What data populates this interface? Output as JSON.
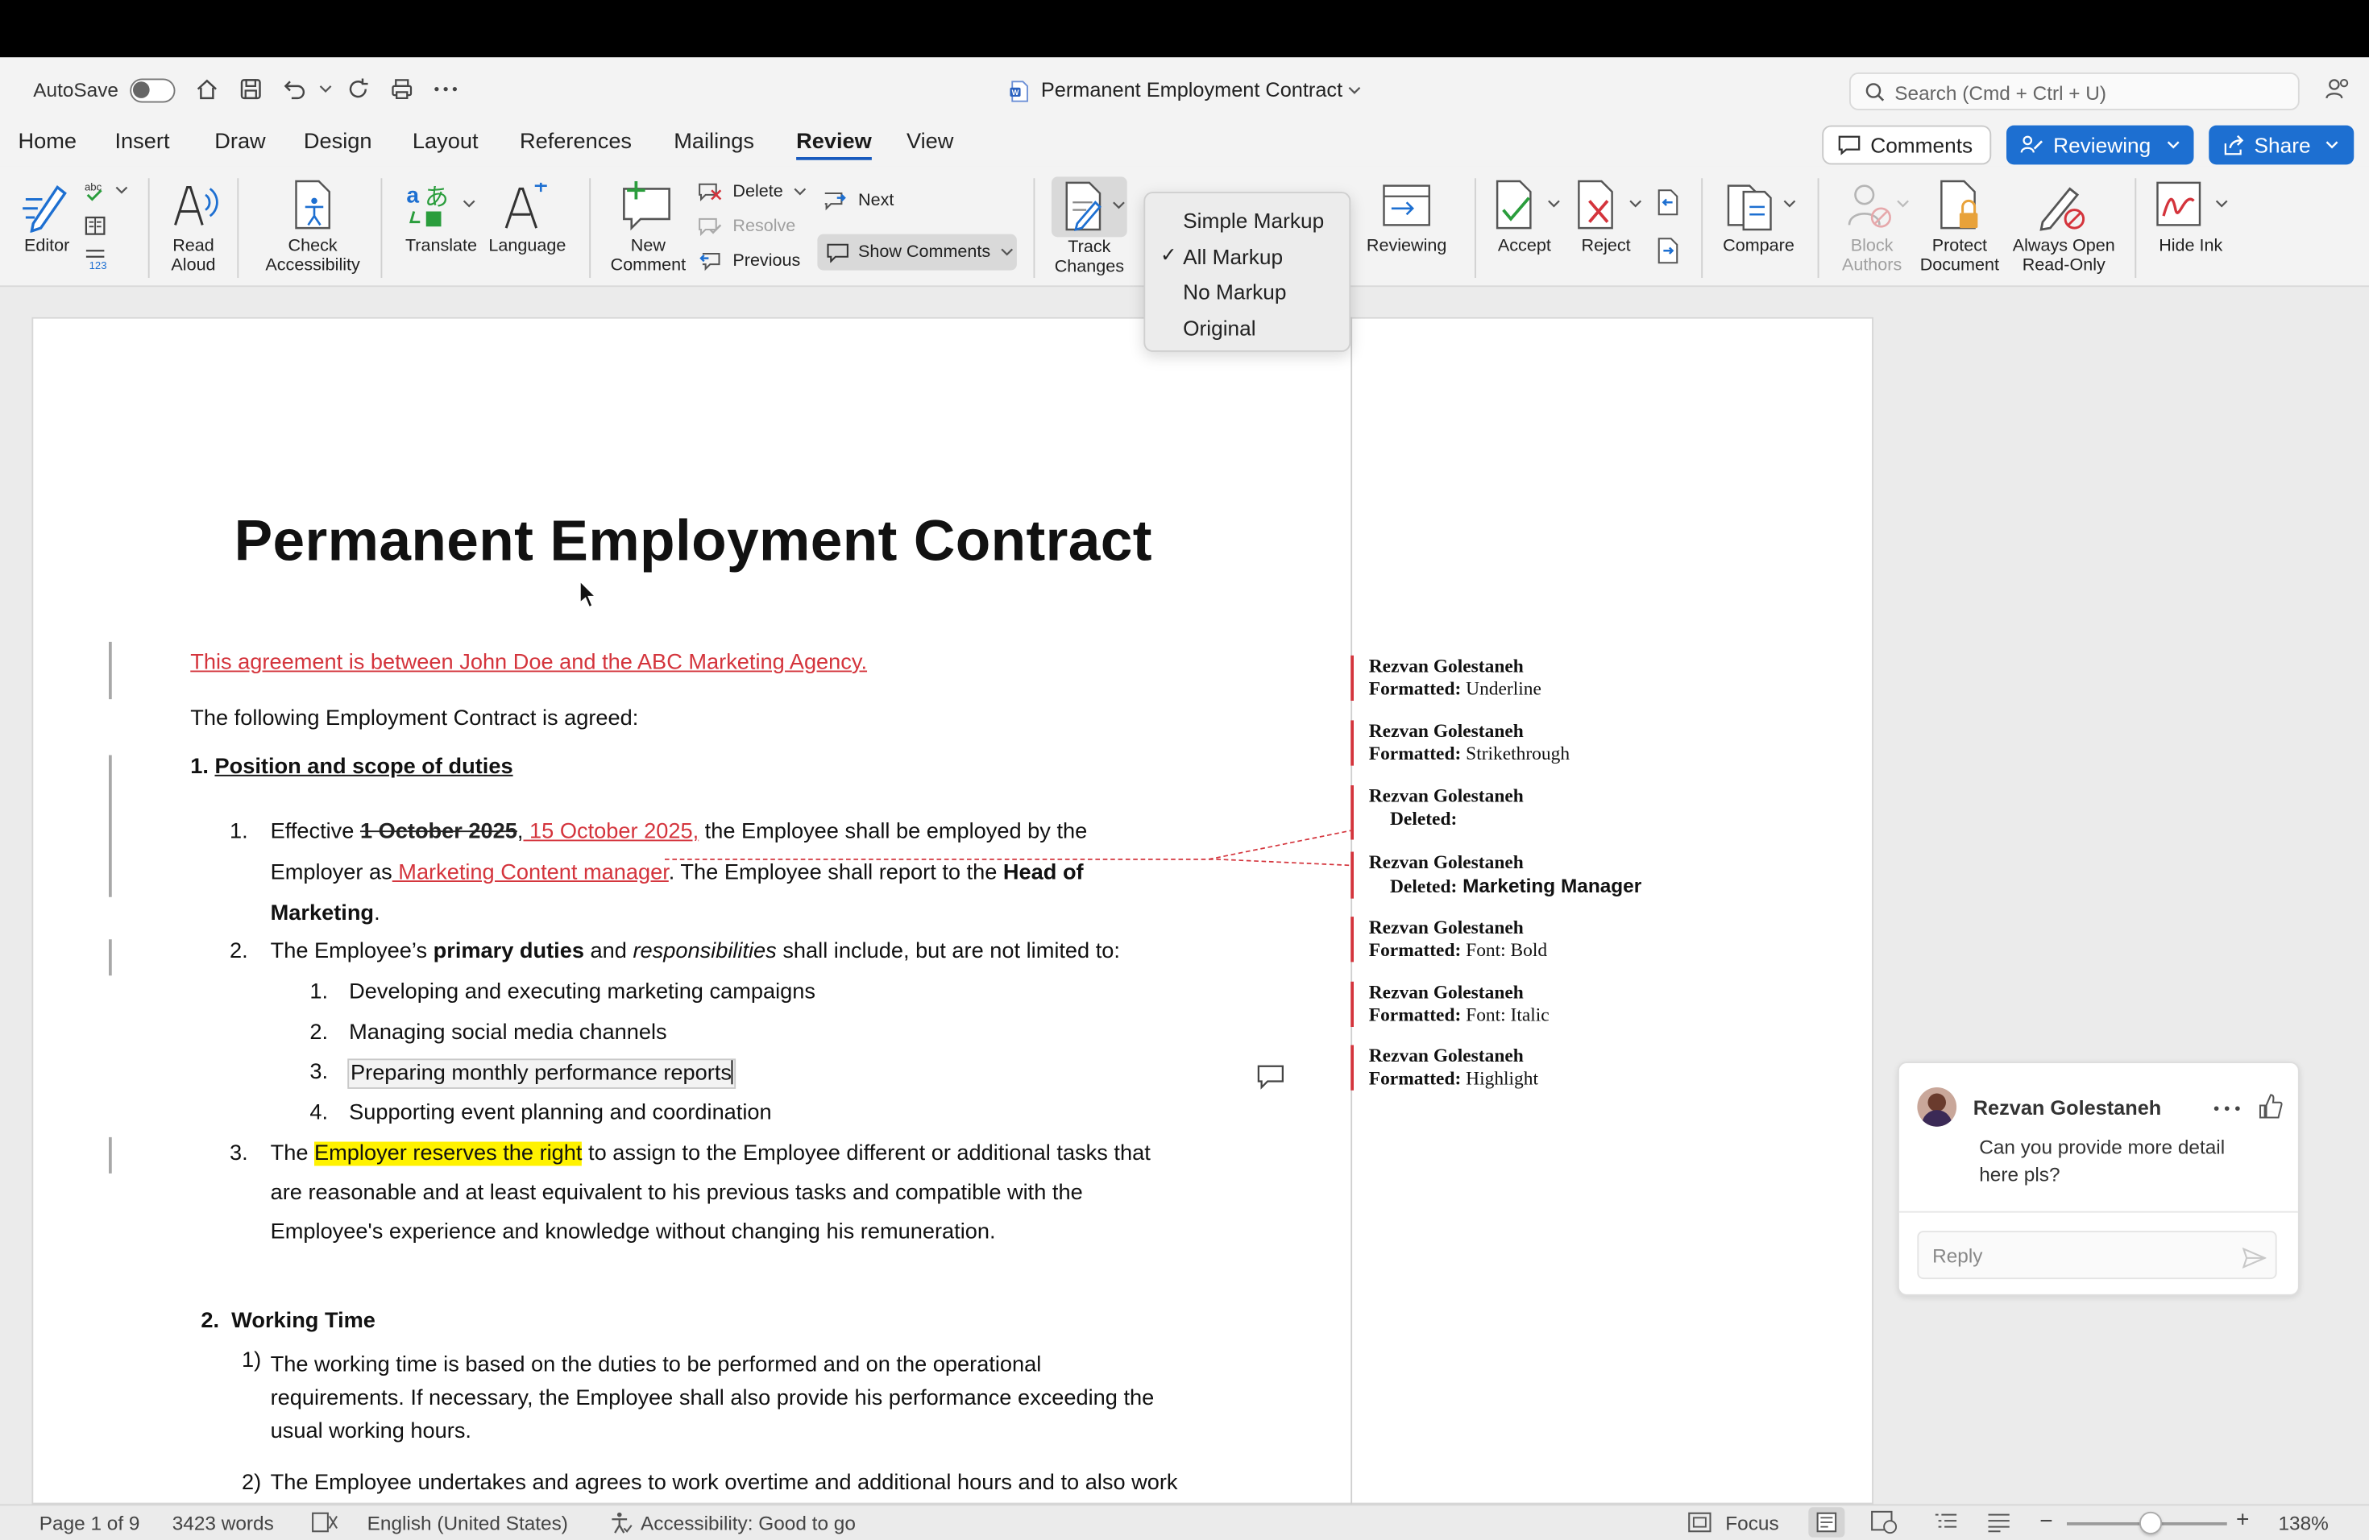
{
  "app": {
    "autosave_label": "AutoSave",
    "document_title": "Permanent Employment Contract",
    "search_placeholder": "Search (Cmd + Ctrl + U)"
  },
  "menu_tabs": [
    "Home",
    "Insert",
    "Draw",
    "Design",
    "Layout",
    "References",
    "Mailings",
    "Review",
    "View"
  ],
  "active_tab": "Review",
  "header_buttons": {
    "comments": "Comments",
    "reviewing": "Reviewing",
    "share": "Share"
  },
  "ribbon": {
    "editor": "Editor",
    "read_aloud": [
      "Read",
      "Aloud"
    ],
    "check_accessibility": [
      "Check",
      "Accessibility"
    ],
    "translate": "Translate",
    "language": "Language",
    "new_comment": [
      "New",
      "Comment"
    ],
    "delete": "Delete",
    "resolve": "Resolve",
    "previous": "Previous",
    "next": "Next",
    "show_comments": "Show Comments",
    "track_changes": [
      "Track",
      "Changes"
    ],
    "reviewing": "Reviewing",
    "accept": "Accept",
    "reject": "Reject",
    "compare": "Compare",
    "block_authors": [
      "Block",
      "Authors"
    ],
    "protect_document": [
      "Protect",
      "Document"
    ],
    "always_open_read_only": [
      "Always Open",
      "Read-Only"
    ],
    "hide_ink": "Hide Ink"
  },
  "markup_dropdown": {
    "items": [
      "Simple Markup",
      "All Markup",
      "No Markup",
      "Original"
    ],
    "checked": "All Markup",
    "check_mark": "✓"
  },
  "document": {
    "title": "Permanent Employment Contract",
    "intro_inserted": "This agreement is between John Doe and the ABC Marketing Agency.",
    "intro2": "The following Employment Contract is agreed:",
    "section1_num": "1.",
    "section1_heading": "Position and scope of duties",
    "item1_num": "1.",
    "item1_a": "Effective ",
    "item1_deleted_date": "1 October 2025",
    "item1_comma": ",",
    "item1_inserted_date": " 15 October 2025,",
    "item1_b": " the Employee shall be employed by the",
    "item1_c": "Employer as",
    "item1_inserted_role": " Marketing Content manager",
    "item1_d": ". The Employee shall report to the ",
    "item1_bold1": "Head of",
    "item1_bold2": "Marketing",
    "item1_end": ".",
    "item2_num": "2.",
    "item2_a": "The Employee’s ",
    "item2_bold": "primary duties",
    "item2_b": " and ",
    "item2_italic": "responsibilities",
    "item2_c": " shall include, but are not limited to:",
    "subitems": [
      {
        "num": "1.",
        "text": "Developing and executing marketing campaigns"
      },
      {
        "num": "2.",
        "text": "Managing social media channels"
      },
      {
        "num": "3.",
        "text": "Preparing monthly performance reports"
      },
      {
        "num": "4.",
        "text": "Supporting event planning and coordination"
      }
    ],
    "item3_num": "3.",
    "item3_a": "The ",
    "item3_highlight": "Employer reserves the right",
    "item3_b": " to assign to the Employee different or additional tasks that",
    "item3_line2": "are reasonable and at least equivalent to his previous tasks and compatible with the",
    "item3_line3": "Employee's experience and knowledge without changing his remuneration.",
    "section2_num": "2.",
    "section2_heading": "Working Time",
    "s2_item1_num": "1)",
    "s2_item1_l1": "The working time is based on the duties to be performed and on the operational",
    "s2_item1_l2": "requirements. If necessary, the Employee shall also provide his performance exceeding the",
    "s2_item1_l3": "usual working hours.",
    "s2_item2_num": "2)",
    "s2_item2_l1": "The Employee undertakes and agrees to work overtime and additional hours and to also work"
  },
  "balloons": [
    {
      "author": "Rezvan Golestaneh",
      "kind": "Formatted:",
      "detail": " Underline"
    },
    {
      "author": "Rezvan Golestaneh",
      "kind": "Formatted:",
      "detail": " Strikethrough"
    },
    {
      "author": "Rezvan Golestaneh",
      "kind": "Deleted:",
      "detail": ""
    },
    {
      "author": "Rezvan Golestaneh",
      "kind": "Deleted:",
      "detail": " Marketing Manager"
    },
    {
      "author": "Rezvan Golestaneh",
      "kind": "Formatted:",
      "detail": " Font: Bold"
    },
    {
      "author": "Rezvan Golestaneh",
      "kind": "Formatted:",
      "detail": " Font: Italic"
    },
    {
      "author": "Rezvan Golestaneh",
      "kind": "Formatted:",
      "detail": " Highlight"
    }
  ],
  "comment": {
    "author": "Rezvan Golestaneh",
    "text_line1": "Can you provide more detail",
    "text_line2": "here pls?",
    "reply_placeholder": "Reply"
  },
  "status": {
    "page": "Page 1 of 9",
    "words": "3423 words",
    "language": "English (United States)",
    "accessibility": "Accessibility: Good to go",
    "focus": "Focus",
    "zoom": "138%"
  },
  "colors": {
    "accent_blue": "#1d6fd1",
    "revision_red": "#d4343c",
    "highlight_yellow": "#fff200"
  }
}
